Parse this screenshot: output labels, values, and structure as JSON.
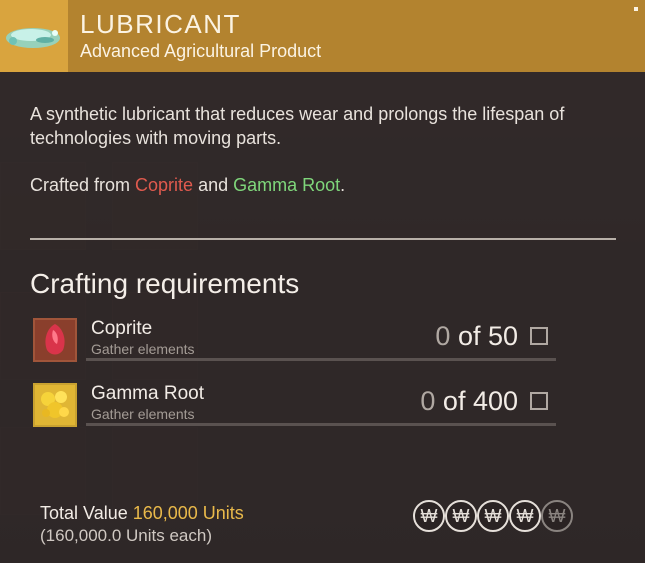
{
  "item": {
    "title": "LUBRICANT",
    "subtitle": "Advanced Agricultural Product",
    "description": "A synthetic lubricant that reduces wear and prolongs the lifespan of technologies with moving parts.",
    "crafted_prefix": "Crafted from ",
    "crafted_ingredient_1": "Coprite",
    "crafted_and": " and ",
    "crafted_ingredient_2": "Gamma Root",
    "crafted_suffix": ".",
    "icon": "lubricant-icon",
    "header_color": "#b3832f"
  },
  "crafting": {
    "title": "Crafting requirements",
    "requirements": [
      {
        "name": "Coprite",
        "subtitle": "Gather elements",
        "have": "0",
        "of": " of 50",
        "icon": "coprite-icon"
      },
      {
        "name": "Gamma Root",
        "subtitle": "Gather elements",
        "have": "0",
        "of": " of 400",
        "icon": "gamma-root-icon"
      }
    ]
  },
  "value": {
    "label": "Total Value ",
    "amount": "160,000 Units",
    "each": "(160,000.0 Units each)",
    "rating_filled": 4,
    "rating_total": 5,
    "coin_glyph": "₩"
  }
}
